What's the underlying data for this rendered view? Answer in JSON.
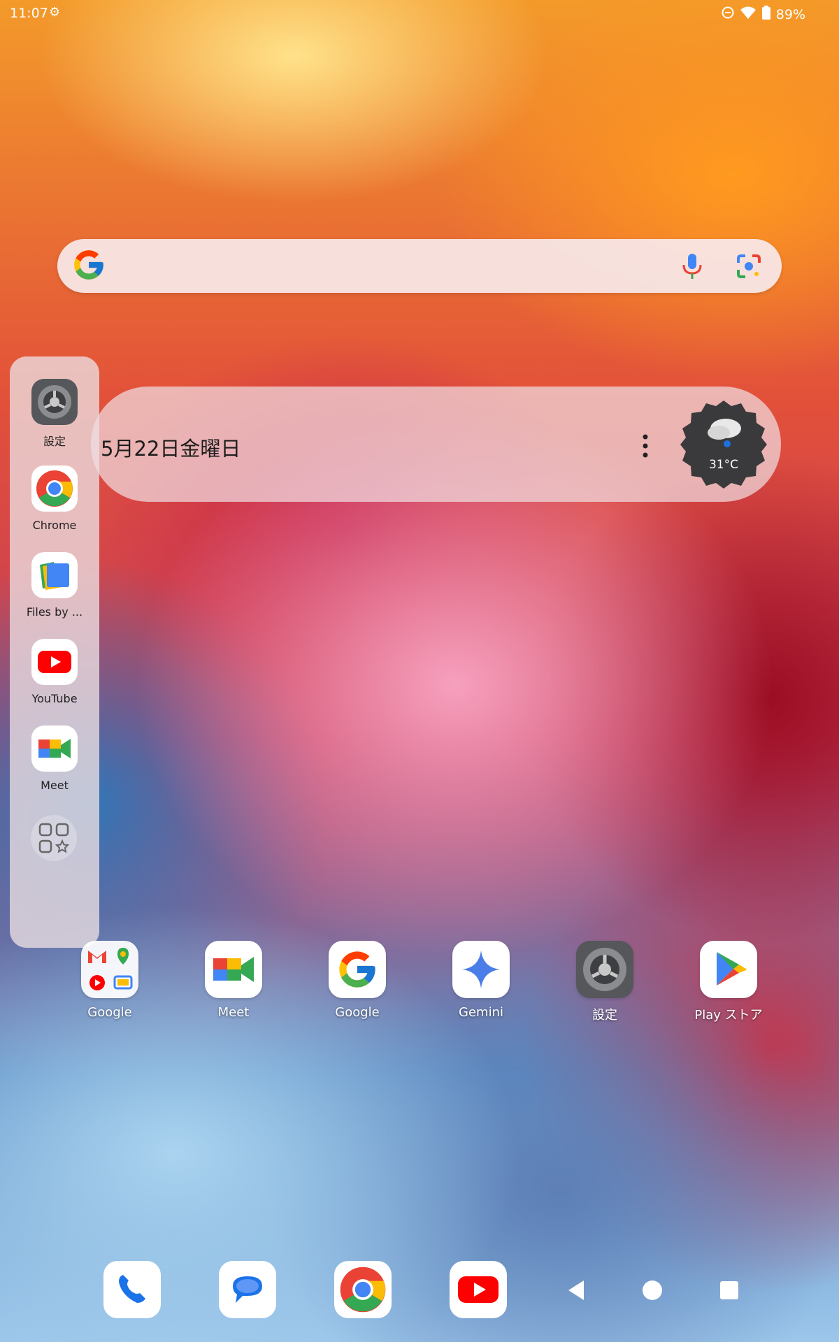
{
  "status_bar": {
    "time": "11:07",
    "battery": "89%"
  },
  "search_bar": {},
  "date_widget": {
    "date": "5月22日金曜日",
    "temperature": "31°C"
  },
  "sidebar": {
    "items": [
      {
        "label": "設定"
      },
      {
        "label": "Chrome"
      },
      {
        "label": "Files by ..."
      },
      {
        "label": "YouTube"
      },
      {
        "label": "Meet"
      }
    ]
  },
  "home_apps": [
    {
      "label": "Google"
    },
    {
      "label": "Meet"
    },
    {
      "label": "Google"
    },
    {
      "label": "Gemini"
    },
    {
      "label": "設定"
    },
    {
      "label": "Play ストア"
    }
  ],
  "colors": {
    "google_blue": "#4285F4",
    "google_red": "#EA4335",
    "google_yellow": "#FBBC05",
    "google_green": "#34A853",
    "youtube_red": "#FF0000"
  }
}
